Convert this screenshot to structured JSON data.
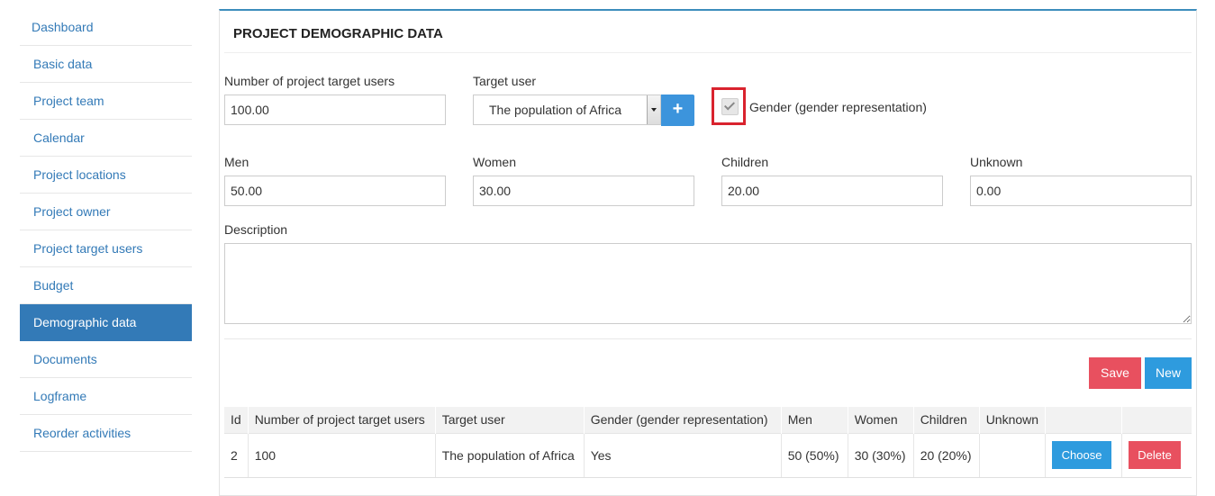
{
  "sidebar": {
    "items": [
      {
        "label": "Dashboard"
      },
      {
        "label": "Basic data"
      },
      {
        "label": "Project team"
      },
      {
        "label": "Calendar"
      },
      {
        "label": "Project locations"
      },
      {
        "label": "Project owner"
      },
      {
        "label": "Project target users"
      },
      {
        "label": "Budget"
      },
      {
        "label": "Demographic data",
        "active": true
      },
      {
        "label": "Documents"
      },
      {
        "label": "Logframe"
      },
      {
        "label": "Reorder activities"
      }
    ]
  },
  "panel": {
    "title": "PROJECT DEMOGRAPHIC DATA"
  },
  "form": {
    "num_users_label": "Number of project target users",
    "num_users_value": "100.00",
    "target_user_label": "Target user",
    "target_user_selected": "The population of Africa",
    "add_button_label": "+",
    "gender_label": "Gender (gender representation)",
    "gender_checked": true,
    "men_label": "Men",
    "men_value": "50.00",
    "women_label": "Women",
    "women_value": "30.00",
    "children_label": "Children",
    "children_value": "20.00",
    "unknown_label": "Unknown",
    "unknown_value": "0.00",
    "description_label": "Description",
    "description_value": ""
  },
  "actions": {
    "save_label": "Save",
    "new_label": "New"
  },
  "table": {
    "columns": [
      "Id",
      "Number of project target users",
      "Target user",
      "Gender (gender representation)",
      "Men",
      "Women",
      "Children",
      "Unknown",
      "",
      ""
    ],
    "rows": [
      {
        "id": "2",
        "num_users": "100",
        "target_user": "The population of Africa",
        "gender": "Yes",
        "men": "50 (50%)",
        "women": "30 (30%)",
        "children": "20 (20%)",
        "unknown": "",
        "choose_label": "Choose",
        "delete_label": "Delete"
      }
    ]
  },
  "colors": {
    "accent": "#337ab7",
    "save": "#e8505f",
    "new": "#2e9bde",
    "highlight": "#d9232e"
  }
}
